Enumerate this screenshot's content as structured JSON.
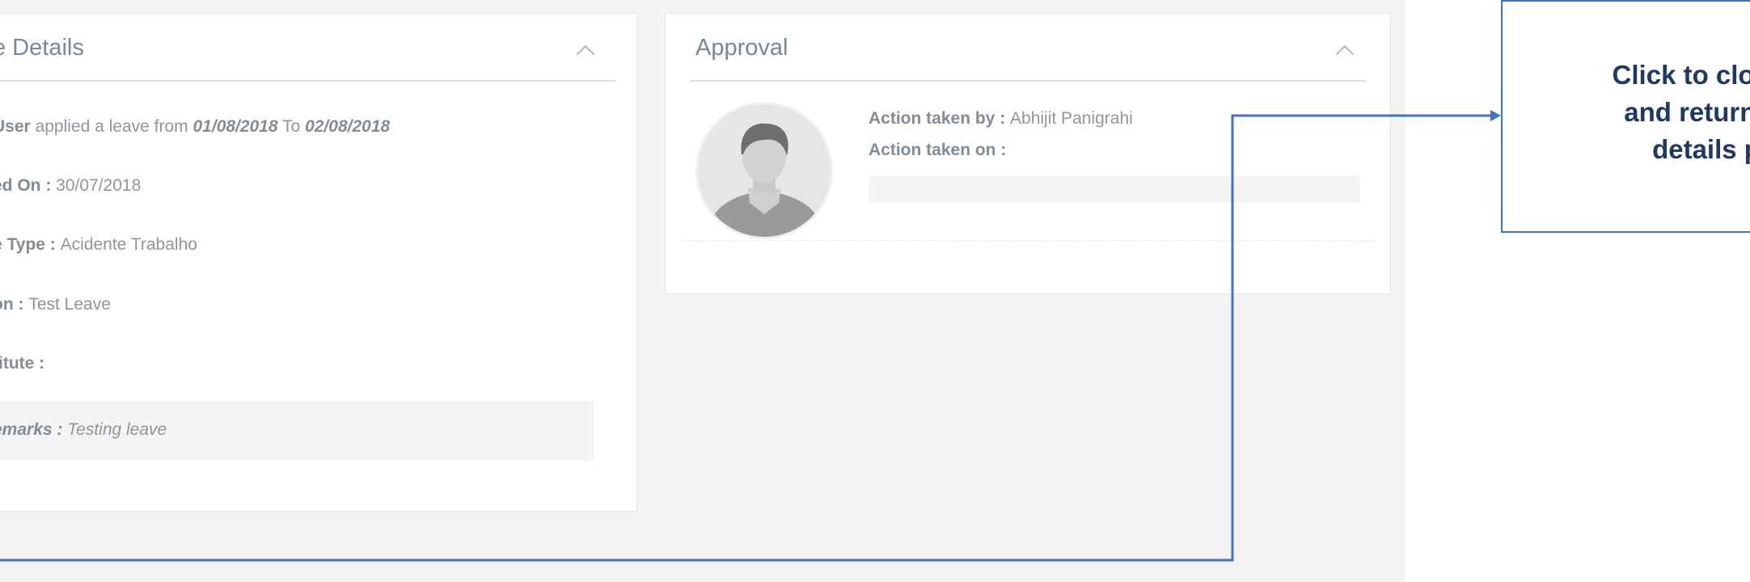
{
  "leave_details": {
    "title": "e Details",
    "applied_prefix": "User",
    "applied_middle": " applied a leave from ",
    "from_date": "01/08/2018",
    "to_word": " To ",
    "to_date": "02/08/2018",
    "applied_on_label": "ed On : ",
    "applied_on_value": "30/07/2018",
    "leave_type_label": "e Type : ",
    "leave_type_value": "Acidente Trabalho",
    "reason_label": "on : ",
    "reason_value": "Test Leave",
    "substitute_label": "titute :",
    "remarks_label": "emarks : ",
    "remarks_value": "Testing leave"
  },
  "approval": {
    "title": "Approval",
    "action_by_label": "Action taken by : ",
    "action_by_value": "Abhijit Panigrahi",
    "action_on_label": "Action taken on :"
  },
  "callout": {
    "line1": "Click to close t",
    "line2": "and return to",
    "line3": "details p"
  },
  "colors": {
    "annotation_blue": "#4472c4",
    "annotation_text": "#1f3864"
  }
}
